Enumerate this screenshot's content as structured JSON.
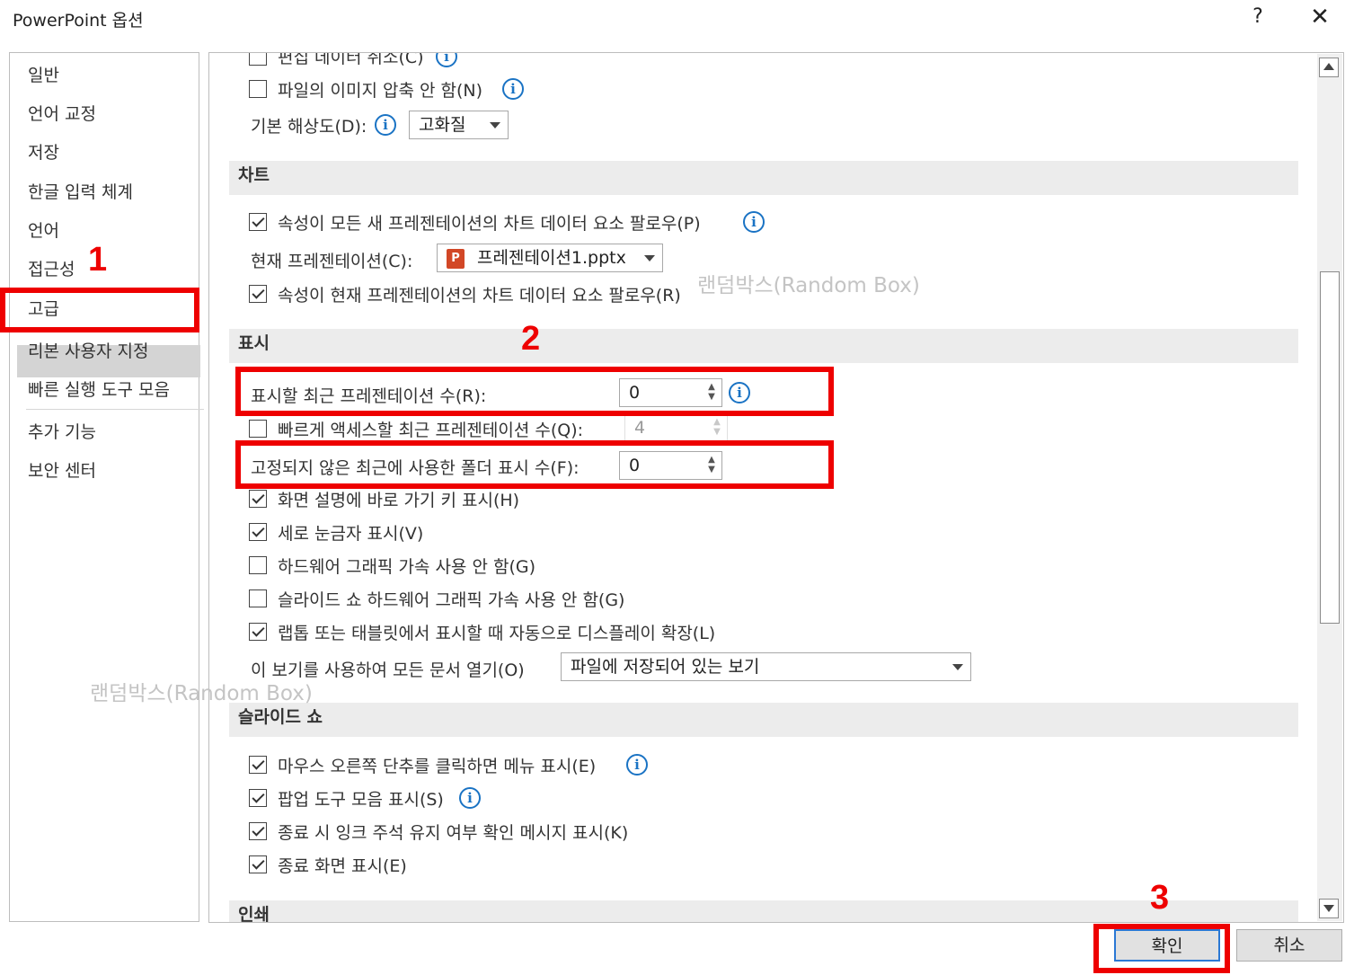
{
  "window": {
    "title": "PowerPoint 옵션",
    "help": "?",
    "close": "✕"
  },
  "sidebar": {
    "items": [
      "일반",
      "언어 교정",
      "저장",
      "한글 입력 체계",
      "언어",
      "접근성",
      "고급",
      "리본 사용자 지정",
      "빠른 실행 도구 모음",
      "추가 기능",
      "보안 센터"
    ],
    "selected": "고급"
  },
  "image_section": {
    "row_partial": "편집 데이터 취소(C)",
    "no_compress": "파일의 이미지 압축 안 함(N)",
    "resolution_label": "기본 해상도(D):",
    "resolution_value": "고화질"
  },
  "chart_section": {
    "header": "차트",
    "follow_all": "속성이 모든 새 프레젠테이션의 차트 데이터 요소 팔로우(P)",
    "current_label": "현재 프레젠테이션(C):",
    "current_value": "프레젠테이션1.pptx",
    "pptx_icon_letter": "P",
    "follow_current": "속성이 현재 프레젠테이션의 차트 데이터 요소 팔로우(R)"
  },
  "display_section": {
    "header": "표시",
    "recent_count_label": "표시할 최근 프레젠테이션 수(R):",
    "recent_count_value": "0",
    "quick_access_label": "빠르게 액세스할 최근 프레젠테이션 수(Q):",
    "quick_access_value": "4",
    "unpinned_folders_label": "고정되지 않은 최근에 사용한 폴더 표시 수(F):",
    "unpinned_folders_value": "0",
    "shortcut_keys": "화면 설명에 바로 가기 키 표시(H)",
    "vertical_ruler": "세로 눈금자 표시(V)",
    "disable_hw_accel": "하드웨어 그래픽 가속 사용 안 함(G)",
    "disable_slideshow_hw_accel": "슬라이드 쇼 하드웨어 그래픽 가속 사용 안 함(G)",
    "auto_scale": "랩톱 또는 태블릿에서 표시할 때 자동으로 디스플레이 확장(L)",
    "open_view_label": "이 보기를 사용하여 모든 문서 열기(O)",
    "open_view_value": "파일에 저장되어 있는 보기"
  },
  "slideshow_section": {
    "header": "슬라이드 쇼",
    "right_click_menu": "마우스 오른쪽 단추를 클릭하면 메뉴 표시(E)",
    "popup_toolbar": "팝업 도구 모음 표시(S)",
    "keep_ink": "종료 시 잉크 주석 유지 여부 확인 메시지 표시(K)",
    "end_screen": "종료 화면 표시(E)"
  },
  "print_section": {
    "header": "인쇄"
  },
  "buttons": {
    "ok": "확인",
    "cancel": "취소"
  },
  "annotations": {
    "step1": "1",
    "step2": "2",
    "step3": "3",
    "color": "#ee0000"
  },
  "watermark": "랜덤박스(Random Box)"
}
